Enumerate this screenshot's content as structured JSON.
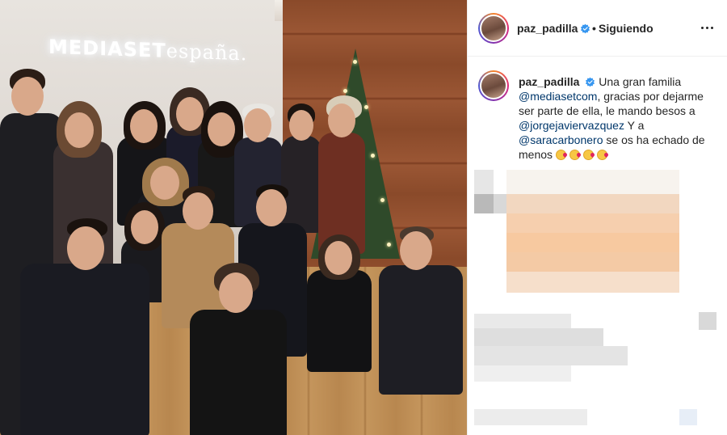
{
  "photo": {
    "sign_main": "MEDIASET",
    "sign_secondary": "españa."
  },
  "post_header": {
    "username": "paz_padilla",
    "separator": "•",
    "follow_status": "Siguiendo"
  },
  "caption": {
    "username": "paz_padilla",
    "text_1": "Una gran familia",
    "mention_1": "@mediasetcom",
    "text_2": ", gracias por dejarme ser parte de ella, le mando besos a",
    "mention_2": "@jorgejaviervazquez",
    "text_3": " Y a",
    "mention_3": "@saracarbonero",
    "text_4": " se os ha echado de menos"
  },
  "icons": {
    "verified": "verified-badge-icon",
    "more": "more-options-icon",
    "emoji": "kissing-face-emoji"
  },
  "colors": {
    "verified_blue": "#3897f0",
    "mention_blue": "#00376b",
    "text": "#262626"
  }
}
